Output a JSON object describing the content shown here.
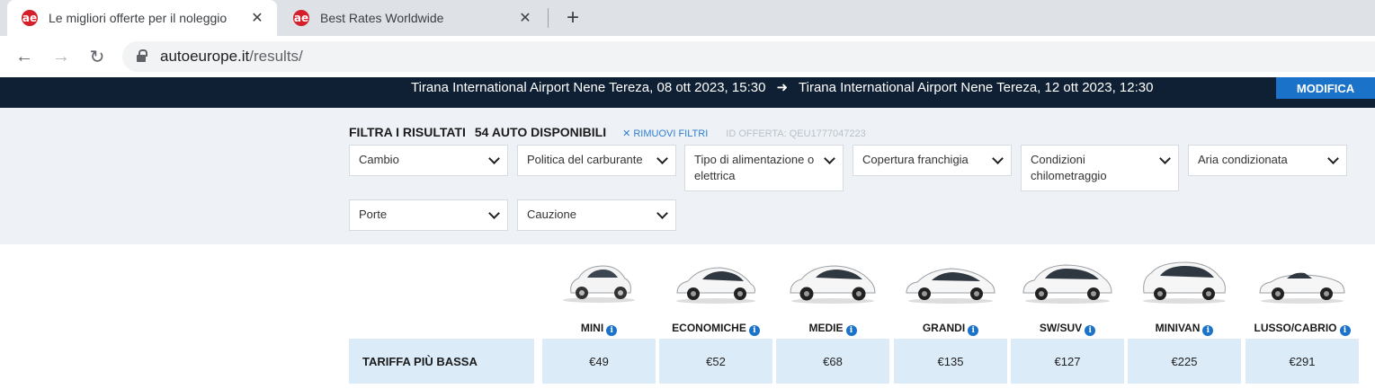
{
  "browser": {
    "tabs": [
      {
        "title": "Le migliori offerte per il noleggio",
        "favicon": "ae"
      },
      {
        "title": "Best Rates Worldwide",
        "favicon": "ae"
      }
    ],
    "url_domain": "autoeurope.it",
    "url_path": "/results/"
  },
  "route": {
    "pickup": "Tirana International Airport Nene Tereza, 08 ott 2023, 15:30",
    "arrow": "➜",
    "dropoff": "Tirana International Airport Nene Tereza, 12 ott 2023, 12:30",
    "modify_label": "MODIFICA"
  },
  "filters": {
    "title": "FILTRA I RISULTATI",
    "count": "54 AUTO DISPONIBILI",
    "remove": "RIMUOVI FILTRI",
    "offer_id": "ID OFFERTA: QEU1777047223",
    "selects": [
      "Cambio",
      "Politica del carburante",
      "Tipo di alimentazione o elettrica",
      "Copertura franchigia",
      "Condizioni chilometraggio",
      "Aria condizionata",
      "Porte",
      "Cauzione"
    ]
  },
  "results": {
    "lowest_label": "TARIFFA PIÙ BASSA",
    "categories": [
      {
        "name": "MINI",
        "price": "€49"
      },
      {
        "name": "ECONOMICHE",
        "price": "€52"
      },
      {
        "name": "MEDIE",
        "price": "€68"
      },
      {
        "name": "GRANDI",
        "price": "€135"
      },
      {
        "name": "SW/SUV",
        "price": "€127"
      },
      {
        "name": "MINIVAN",
        "price": "€225"
      },
      {
        "name": "LUSSO/CABRIO",
        "price": "€291"
      }
    ]
  },
  "colors": {
    "brand_red": "#d3202a",
    "banner": "#0f1f34",
    "accent_blue": "#1a73c9",
    "price_cell": "#dcebf8"
  }
}
